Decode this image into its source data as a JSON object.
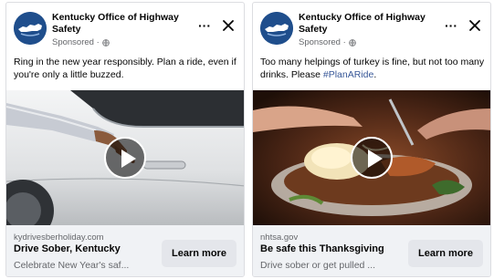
{
  "ads": [
    {
      "page_name": "Kentucky Office of Highway Safety",
      "sponsored": "Sponsored ·",
      "more_label": "···",
      "caption": "Ring in the new year responsibly. Plan a ride, even if you're only a little buzzed.",
      "link_domain": "kydrivesberholiday.com",
      "headline": "Drive Sober, Kentucky",
      "description": "Celebrate New Year's saf...",
      "cta_label": "Learn more"
    },
    {
      "page_name": "Kentucky Office of Highway Safety",
      "sponsored": "Sponsored ·",
      "more_label": "···",
      "caption": "Too many helpings of turkey is fine, but not too many drinks. Please ",
      "hashtag": "#PlanARide",
      "caption_end": ".",
      "link_domain": "nhtsa.gov",
      "headline": "Be safe this Thanksgiving",
      "description": "Drive sober or get pulled ...",
      "cta_label": "Learn more"
    }
  ],
  "icons": {
    "avatar": "kentucky-state-logo",
    "globe": "globe-icon",
    "more": "more-options-icon",
    "close": "close-icon",
    "play": "play-icon"
  },
  "colors": {
    "link": "#385898",
    "secondary_text": "#65676b",
    "footer_bg": "#f0f2f5",
    "button_bg": "#e4e6eb",
    "avatar_bg": "#1f4e8c"
  }
}
